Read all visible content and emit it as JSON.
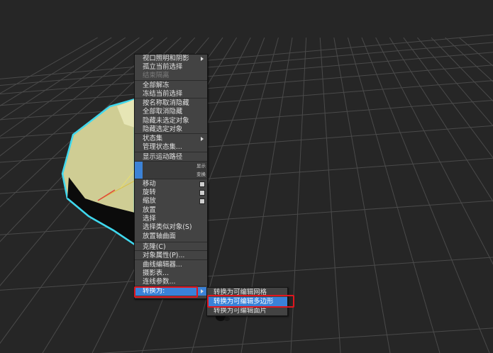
{
  "quad_menu": {
    "items": [
      {
        "label": "视口照明和阴影",
        "submenu": true
      },
      {
        "label": "孤立当前选择"
      },
      {
        "label": "结束隔离",
        "disabled": true
      },
      {
        "label": "全部解冻"
      },
      {
        "label": "冻结当前选择"
      },
      {
        "label": "按名称取消隐藏"
      },
      {
        "label": "全部取消隐藏"
      },
      {
        "label": "隐藏未选定对象"
      },
      {
        "label": "隐藏选定对象"
      },
      {
        "label": "状态集",
        "submenu": true
      },
      {
        "label": "管理状态集..."
      },
      {
        "label": "显示运动路径"
      },
      {
        "label": "移动",
        "box": true
      },
      {
        "label": "旋转",
        "box": true
      },
      {
        "label": "缩放",
        "box": true
      },
      {
        "label": "放置"
      },
      {
        "label": "选择"
      },
      {
        "label": "选择类似对象(S)"
      },
      {
        "label": "放置轴曲面"
      },
      {
        "label": "克隆(C)"
      },
      {
        "label": "对象属性(P)..."
      },
      {
        "label": "曲线编辑器..."
      },
      {
        "label": "摄影表..."
      },
      {
        "label": "连线参数..."
      },
      {
        "label": "转换为:",
        "submenu": true,
        "highlight": true
      }
    ],
    "quad_labels": [
      "显示",
      "变换"
    ]
  },
  "submenu": {
    "items": [
      {
        "label": "转换为可编辑网格"
      },
      {
        "label": "转换为可编辑多边形",
        "highlight": true
      },
      {
        "label": "转换为可编辑面片"
      }
    ]
  },
  "colors": {
    "background": "#262626",
    "grid": "#4a4a4a",
    "menu_bg": "#434343",
    "highlight": "#3a82d8",
    "annotation_red": "#e0161e",
    "selection_outline": "#3fd8ee",
    "object_face": "#dcdba4",
    "object_shadow": "#0b0b0b"
  },
  "icons": [
    "arrow-right-icon",
    "option-box-icon",
    "teapot-cursor-icon"
  ]
}
